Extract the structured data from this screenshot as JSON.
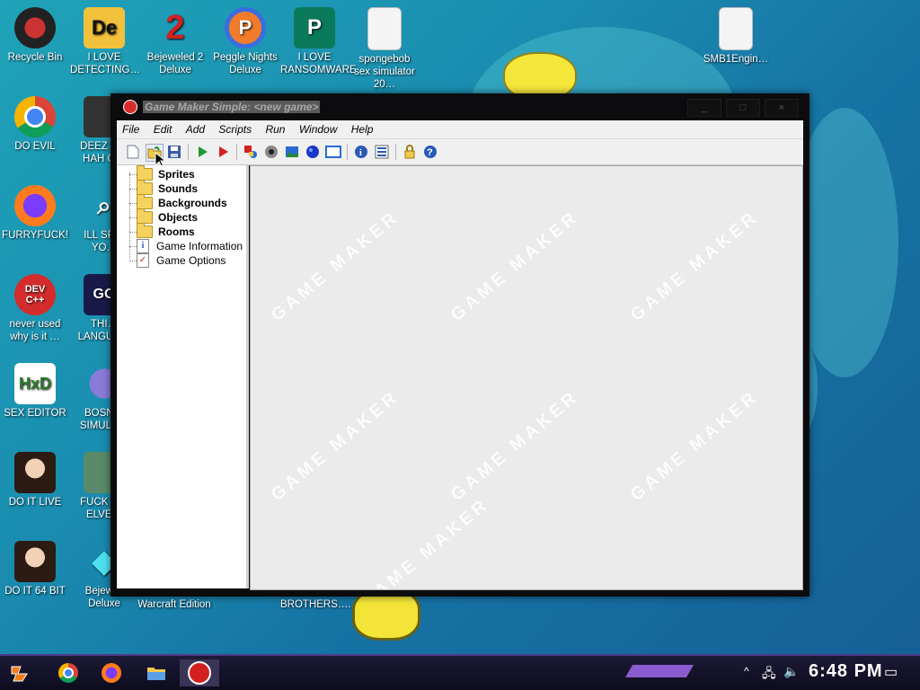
{
  "desktop": {
    "icons": [
      {
        "label": "Recycle Bin",
        "icon": "recycle-bin-icon"
      },
      {
        "label": "I LOVE DETECTING…",
        "icon": "detect-it-easy-icon"
      },
      {
        "label": "Bejeweled 2 Deluxe",
        "icon": "bejeweled-icon"
      },
      {
        "label": "Peggle Nights Deluxe",
        "icon": "peggle-icon"
      },
      {
        "label": "I LOVE RANSOMWARE",
        "icon": "publisher-icon"
      },
      {
        "label": "spongebob sex simulator 20…",
        "icon": "file-icon"
      },
      {
        "label": "SMB1Engin…",
        "icon": "file-icon"
      },
      {
        "label": "DO EVIL",
        "icon": "chrome-icon"
      },
      {
        "label": "DEEZ N… HAH G…",
        "icon": "computer-icon"
      },
      {
        "label": "FURRYFUCK!",
        "icon": "firefox-icon"
      },
      {
        "label": "ILL SP… YO…",
        "icon": "search-icon"
      },
      {
        "label": "never used why is it …",
        "icon": "devcpp-icon"
      },
      {
        "label": "THI… LANGUA…",
        "icon": "golang-icon"
      },
      {
        "label": "SEX EDITOR",
        "icon": "hxd-icon"
      },
      {
        "label": "BOSN… SIMULA…",
        "icon": "virus-icon"
      },
      {
        "label": "DO IT LIVE",
        "icon": "portrait-icon"
      },
      {
        "label": "FUCK S… ELVE…",
        "icon": "game-icon"
      },
      {
        "label": "DO IT 64 BIT",
        "icon": "portrait-icon"
      },
      {
        "label": "Bejew… Deluxe",
        "icon": "diamond-icon"
      },
      {
        "label": "Warcraft Edition",
        "icon": "game-icon"
      },
      {
        "label": "BROTHERS….",
        "icon": "game-icon"
      }
    ]
  },
  "window": {
    "title": "Game Maker Simple: <new game>",
    "minimize": "_",
    "maximize": "□",
    "close": "×",
    "menu": [
      "File",
      "Edit",
      "Add",
      "Scripts",
      "Run",
      "Window",
      "Help"
    ],
    "toolbar": [
      "new-file-icon",
      "open-folder-icon",
      "save-icon",
      "run-icon",
      "run-debug-icon",
      "add-sprite-icon",
      "add-sound-icon",
      "add-background-icon",
      "add-object-icon",
      "add-room-icon",
      "game-information-icon",
      "game-options-icon",
      "lock-icon",
      "help-icon"
    ],
    "tree": [
      {
        "label": "Sprites",
        "type": "folder"
      },
      {
        "label": "Sounds",
        "type": "folder"
      },
      {
        "label": "Backgrounds",
        "type": "folder"
      },
      {
        "label": "Objects",
        "type": "folder"
      },
      {
        "label": "Rooms",
        "type": "folder"
      },
      {
        "label": "Game Information",
        "type": "info"
      },
      {
        "label": "Game Options",
        "type": "options"
      }
    ],
    "watermark": "GAME MAKER"
  },
  "taskbar": {
    "apps": [
      "start-icon",
      "chrome-icon",
      "firefox-icon",
      "file-explorer-icon",
      "game-maker-icon"
    ],
    "clock": "6:48 PM"
  },
  "colors": {
    "accent": "#4d3a8a",
    "window_frame": "#0c0c0e"
  }
}
